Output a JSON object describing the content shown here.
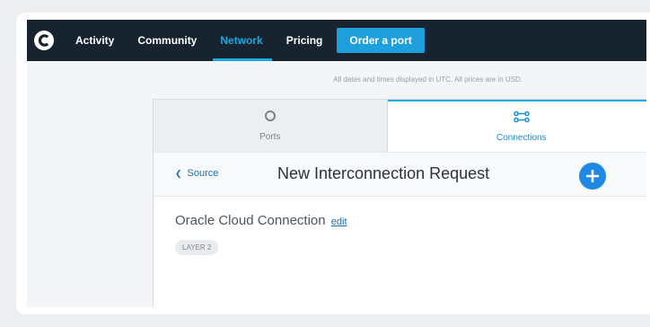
{
  "nav": {
    "items": [
      {
        "label": "Activity"
      },
      {
        "label": "Community"
      },
      {
        "label": "Network"
      },
      {
        "label": "Pricing"
      }
    ],
    "order_button": "Order a port",
    "active": "Network"
  },
  "notice": "All dates and times displayed in UTC. All prices are in USD.",
  "tabs": [
    {
      "label": "Ports",
      "icon": "port-circle-icon"
    },
    {
      "label": "Connections",
      "icon": "connections-icon"
    }
  ],
  "request": {
    "back_label": "Source",
    "title": "New Interconnection Request",
    "add_icon": "plus-icon"
  },
  "connection": {
    "name": "Oracle Cloud Connection",
    "edit_label": "edit",
    "badge": "LAYER 2"
  },
  "colors": {
    "nav_bg": "#172430",
    "accent": "#1ea7e1",
    "add_button": "#1e88e5"
  }
}
